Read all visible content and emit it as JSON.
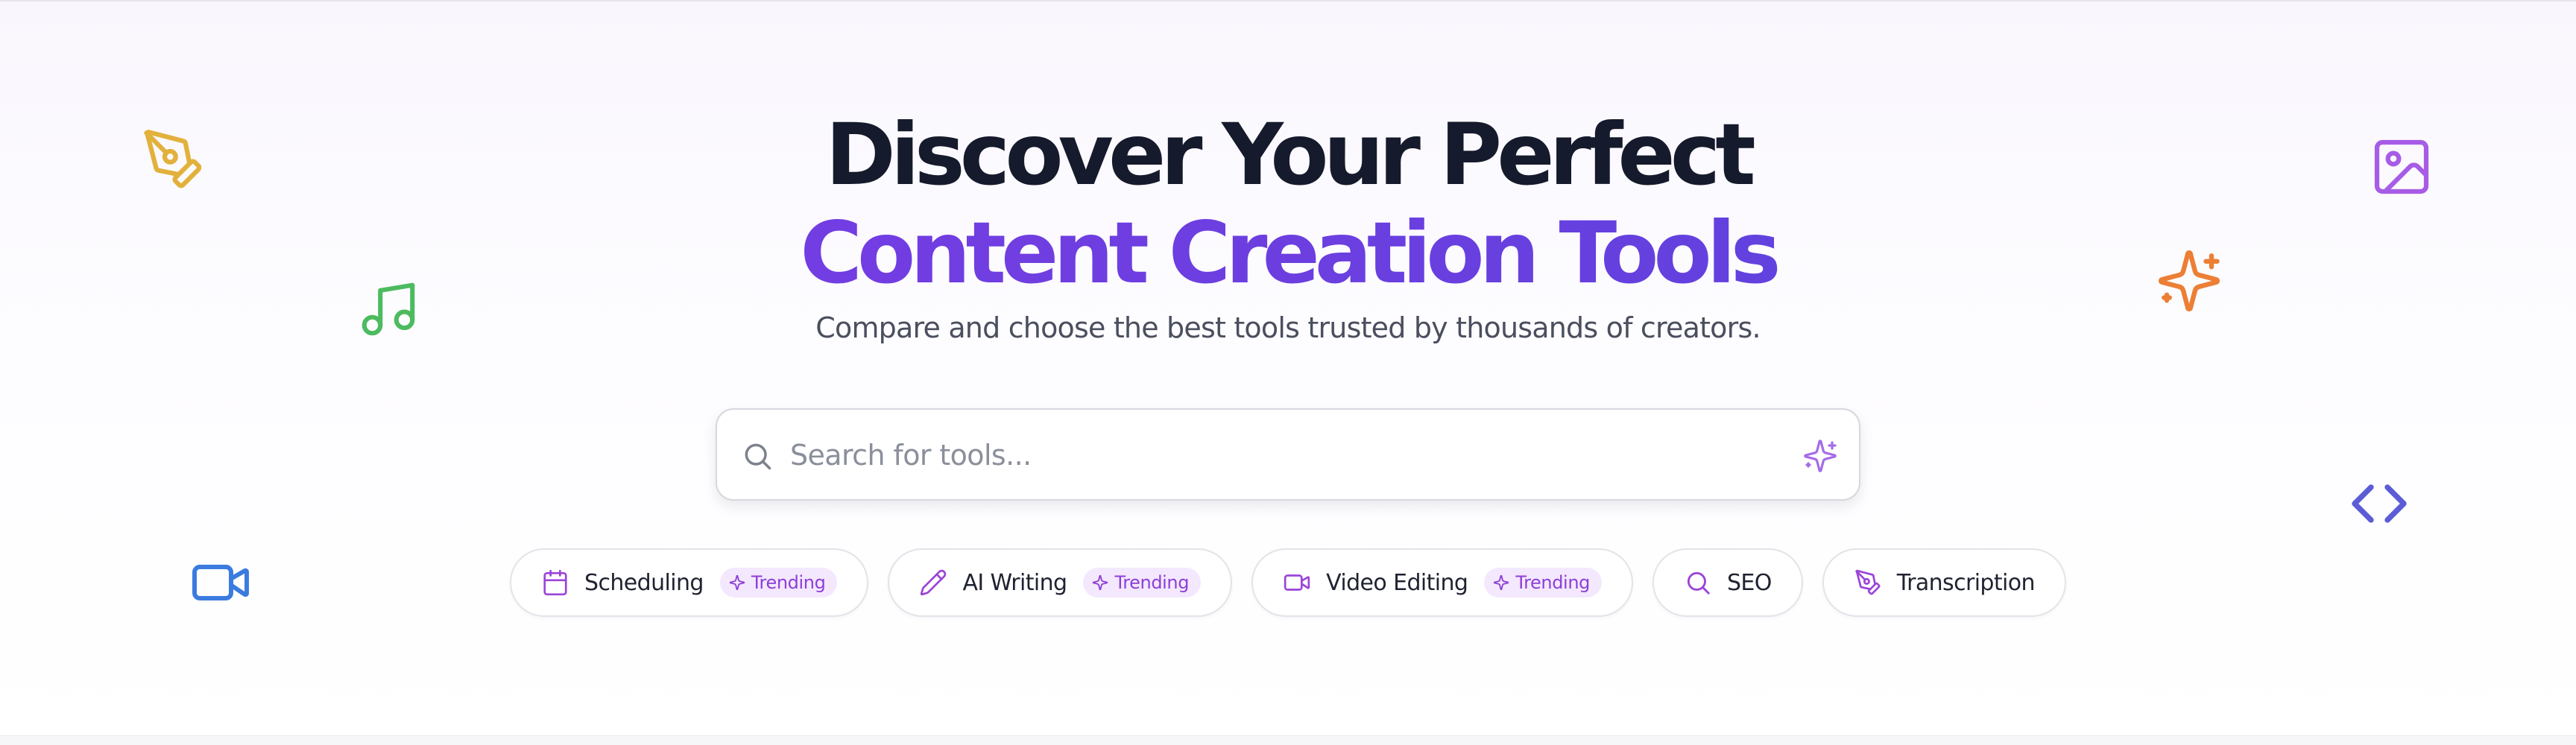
{
  "hero": {
    "title_line1": "Discover Your Perfect",
    "title_line2": "Content Creation Tools",
    "subtitle": "Compare and choose the best tools trusted by thousands of creators."
  },
  "search": {
    "placeholder": "Search for tools...",
    "value": "",
    "icon": "search-icon",
    "ai_icon": "sparkles-icon"
  },
  "categories": [
    {
      "label": "Scheduling",
      "icon": "calendar-icon",
      "badge": "Trending"
    },
    {
      "label": "AI Writing",
      "icon": "pencil-icon",
      "badge": "Trending"
    },
    {
      "label": "Video Editing",
      "icon": "video-icon",
      "badge": "Trending"
    },
    {
      "label": "SEO",
      "icon": "search-icon",
      "badge": null
    },
    {
      "label": "Transcription",
      "icon": "pen-tool-icon",
      "badge": null
    }
  ],
  "decorations": [
    {
      "icon": "pen-tool-icon",
      "color": "#e2b13c"
    },
    {
      "icon": "music-note-icon",
      "color": "#4cbb5f"
    },
    {
      "icon": "video-camera-icon",
      "color": "#3b7be0"
    },
    {
      "icon": "image-icon",
      "color": "#a75ce6"
    },
    {
      "icon": "sparkles-icon",
      "color": "#ec7f35"
    },
    {
      "icon": "code-icon",
      "color": "#5b5cd6"
    }
  ],
  "colors": {
    "title_dark": "#151a2c",
    "accent_start": "#7e3ae4",
    "accent_end": "#5147d8",
    "chip_icon": "#9b44d8",
    "badge_bg": "#f3e8fd",
    "badge_text": "#8e3ed8"
  }
}
